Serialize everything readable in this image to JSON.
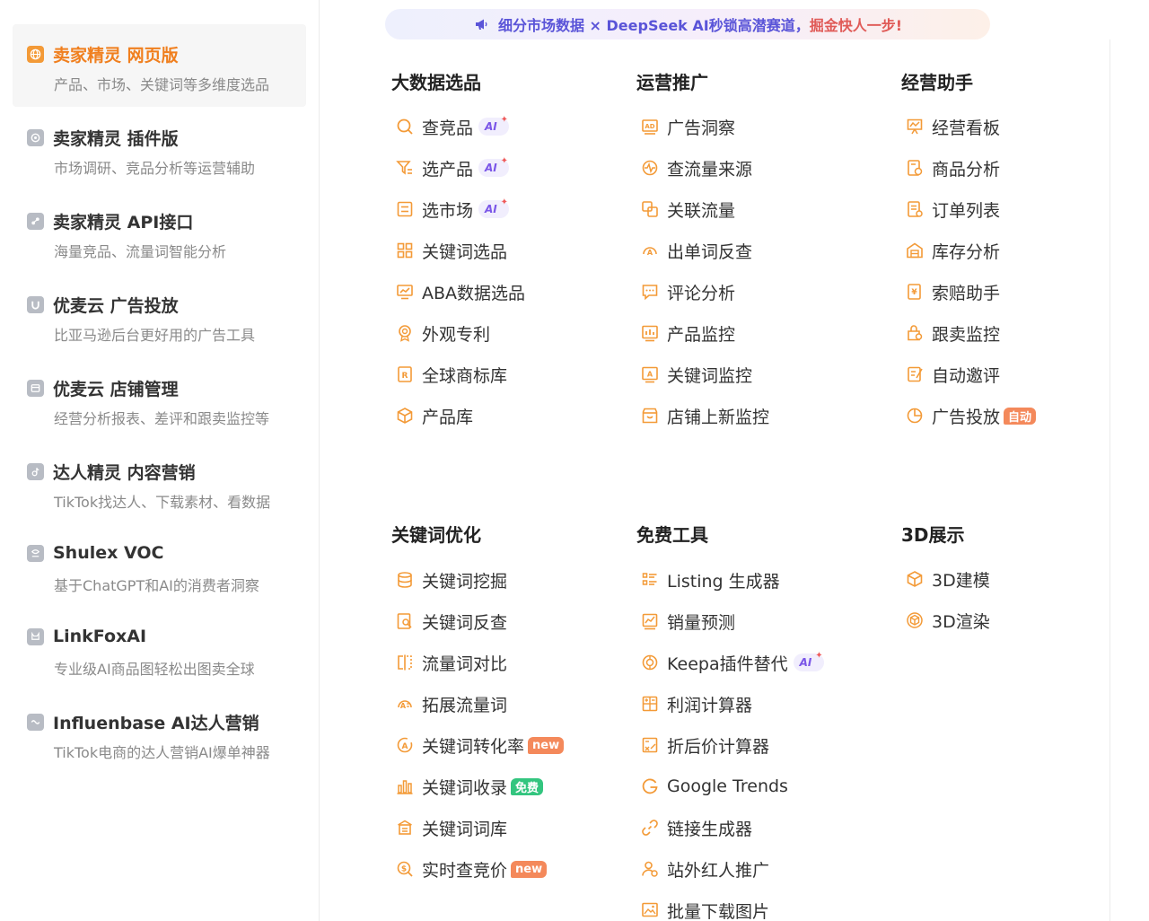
{
  "banner": {
    "text_prefix": "细分市场数据 × DeepSeek AI秒锁高潜赛道，",
    "text_highlight": "掘金快人一步!"
  },
  "sidebar": {
    "items": [
      {
        "title": "卖家精灵 网页版",
        "desc": "产品、市场、关键词等多维度选品",
        "icon": "globe-icon",
        "active": true
      },
      {
        "title": "卖家精灵 插件版",
        "desc": "市场调研、竞品分析等运营辅助",
        "icon": "plugin-icon"
      },
      {
        "title": "卖家精灵 API接口",
        "desc": "海量竞品、流量词智能分析",
        "icon": "api-icon"
      },
      {
        "title": "优麦云 广告投放",
        "desc": "比亚马逊后台更好用的广告工具",
        "icon": "umy-icon"
      },
      {
        "title": "优麦云 店铺管理",
        "desc": "经营分析报表、差评和跟卖监控等",
        "icon": "store-icon"
      },
      {
        "title": "达人精灵 内容营销",
        "desc": "TikTok找达人、下载素材、看数据",
        "icon": "tiktok-icon"
      },
      {
        "title": "Shulex VOC",
        "desc": "基于ChatGPT和AI的消费者洞察",
        "icon": "shulex-icon"
      },
      {
        "title": "LinkFoxAI",
        "desc": "专业级AI商品图轻松出图卖全球",
        "icon": "linkfox-icon"
      },
      {
        "title": "Influenbase AI达人营销",
        "desc": "TikTok电商的达人营销AI爆单神器",
        "icon": "influenbase-icon"
      }
    ]
  },
  "sections": [
    {
      "title": "大数据选品",
      "items": [
        {
          "label": "查竞品",
          "icon": "search-icon",
          "badge": "AI"
        },
        {
          "label": "选产品",
          "icon": "filter-icon",
          "badge": "AI"
        },
        {
          "label": "选市场",
          "icon": "market-icon",
          "badge": "AI"
        },
        {
          "label": "关键词选品",
          "icon": "grid-icon"
        },
        {
          "label": "ABA数据选品",
          "icon": "chart-screen-icon"
        },
        {
          "label": "外观专利",
          "icon": "badge-icon"
        },
        {
          "label": "全球商标库",
          "icon": "trademark-icon"
        },
        {
          "label": "产品库",
          "icon": "box-icon"
        }
      ]
    },
    {
      "title": "运营推广",
      "items": [
        {
          "label": "广告洞察",
          "icon": "ad-icon"
        },
        {
          "label": "查流量来源",
          "icon": "pulse-icon"
        },
        {
          "label": "关联流量",
          "icon": "link-squares-icon"
        },
        {
          "label": "出单词反查",
          "icon": "reverse-icon"
        },
        {
          "label": "评论分析",
          "icon": "comment-icon"
        },
        {
          "label": "产品监控",
          "icon": "bar-monitor-icon"
        },
        {
          "label": "关键词监控",
          "icon": "keyword-monitor-icon"
        },
        {
          "label": "店铺上新监控",
          "icon": "shop-icon"
        }
      ]
    },
    {
      "title": "经营助手",
      "items": [
        {
          "label": "经营看板",
          "icon": "dashboard-icon"
        },
        {
          "label": "商品分析",
          "icon": "goods-icon"
        },
        {
          "label": "订单列表",
          "icon": "order-icon"
        },
        {
          "label": "库存分析",
          "icon": "warehouse-icon"
        },
        {
          "label": "索赔助手",
          "icon": "claim-icon"
        },
        {
          "label": "跟卖监控",
          "icon": "follow-icon"
        },
        {
          "label": "自动邀评",
          "icon": "review-icon"
        },
        {
          "label": "广告投放",
          "icon": "pie-icon",
          "tag": "自动",
          "tag_color": "orange"
        }
      ]
    },
    {
      "title": "关键词优化",
      "items": [
        {
          "label": "关键词挖掘",
          "icon": "database-icon"
        },
        {
          "label": "关键词反查",
          "icon": "doc-search-icon"
        },
        {
          "label": "流量词对比",
          "icon": "compare-icon"
        },
        {
          "label": "拓展流量词",
          "icon": "expand-icon"
        },
        {
          "label": "关键词转化率",
          "icon": "convert-icon",
          "tag": "new",
          "tag_color": "orange"
        },
        {
          "label": "关键词收录",
          "icon": "bars-icon",
          "tag": "免费",
          "tag_color": "green"
        },
        {
          "label": "关键词词库",
          "icon": "library-icon"
        },
        {
          "label": "实时查竞价",
          "icon": "bid-icon",
          "tag": "new",
          "tag_color": "orange"
        }
      ]
    },
    {
      "title": "免费工具",
      "items": [
        {
          "label": "Listing 生成器",
          "icon": "list-icon"
        },
        {
          "label": "销量预测",
          "icon": "forecast-icon"
        },
        {
          "label": "Keepa插件替代",
          "icon": "keepa-icon",
          "badge": "AI"
        },
        {
          "label": "利润计算器",
          "icon": "calculator-icon"
        },
        {
          "label": "折后价计算器",
          "icon": "discount-icon"
        },
        {
          "label": "Google Trends",
          "icon": "google-icon"
        },
        {
          "label": "链接生成器",
          "icon": "chain-icon"
        },
        {
          "label": "站外红人推广",
          "icon": "influencer-icon"
        },
        {
          "label": "批量下载图片",
          "icon": "image-download-icon"
        }
      ]
    },
    {
      "title": "3D展示",
      "items": [
        {
          "label": "3D建模",
          "icon": "cube-icon"
        },
        {
          "label": "3D渲染",
          "icon": "render-icon"
        }
      ]
    }
  ]
}
